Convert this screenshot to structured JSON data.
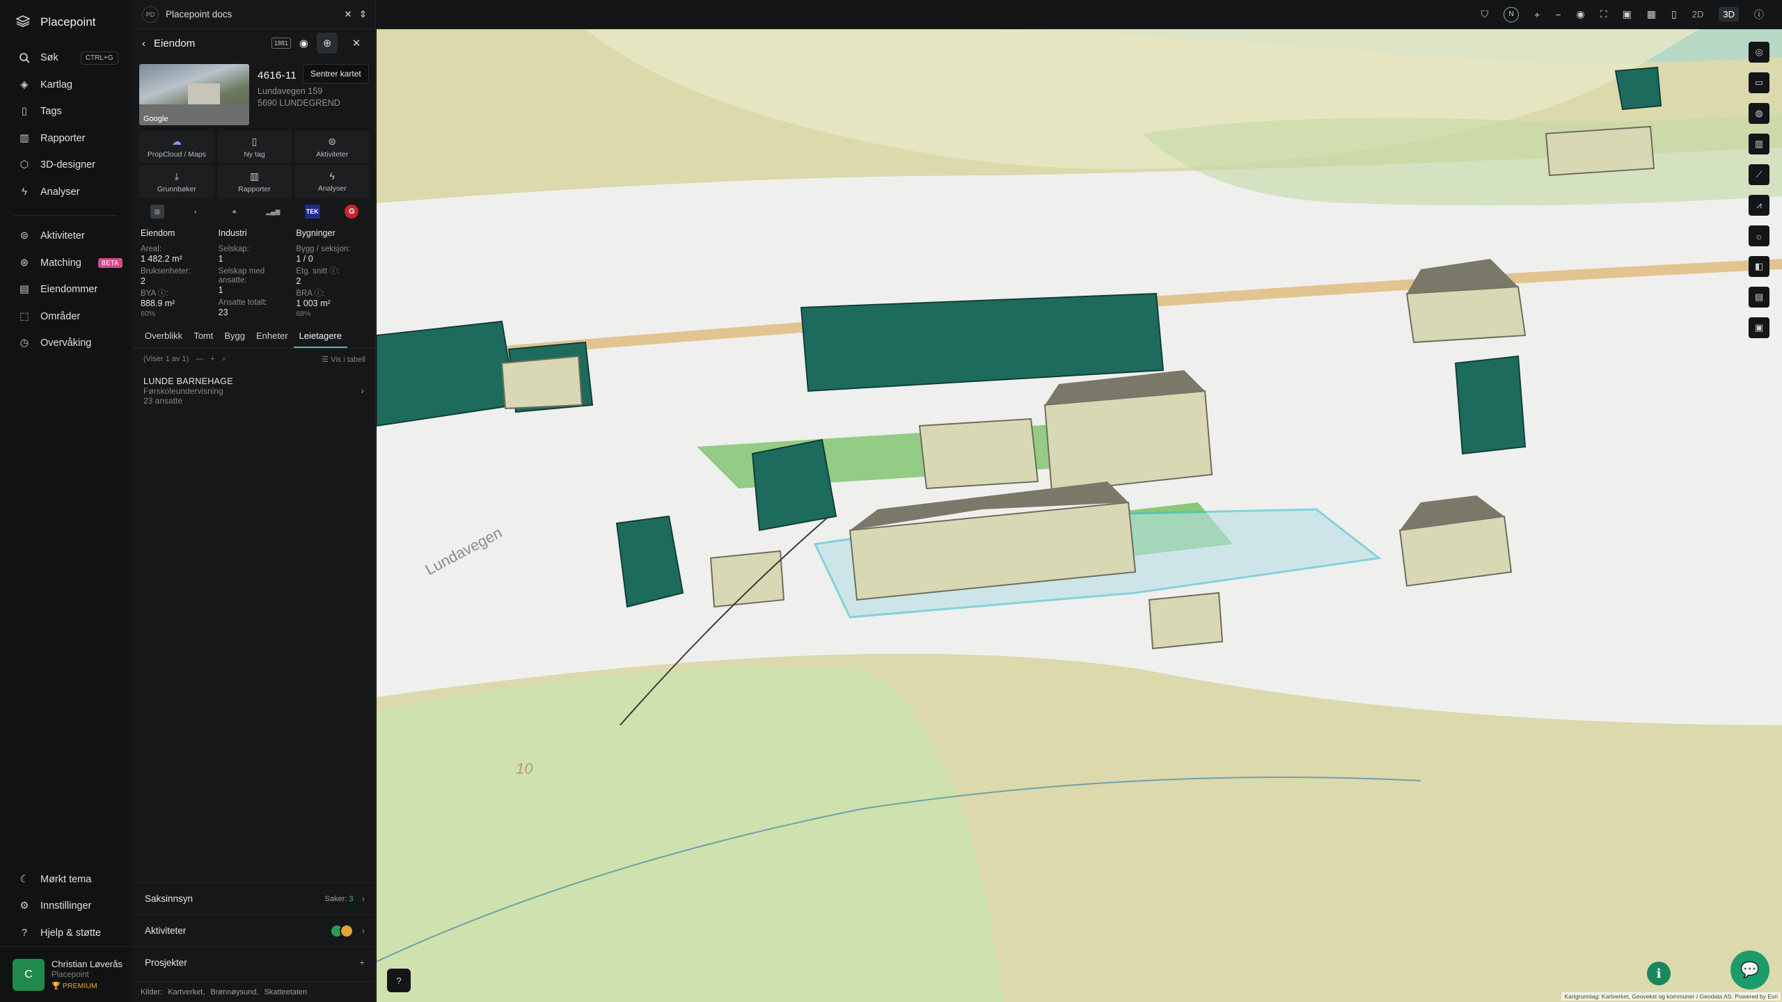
{
  "app": {
    "name": "Placepoint"
  },
  "nav": {
    "items": [
      {
        "label": "Søk",
        "shortcut": "CTRL+G"
      },
      {
        "label": "Kartlag"
      },
      {
        "label": "Tags"
      },
      {
        "label": "Rapporter"
      },
      {
        "label": "3D-designer"
      },
      {
        "label": "Analyser"
      }
    ],
    "items2": [
      {
        "label": "Aktiviteter"
      },
      {
        "label": "Matching",
        "badge": "BETA"
      },
      {
        "label": "Eiendommer"
      },
      {
        "label": "Områder"
      },
      {
        "label": "Overvåking"
      }
    ],
    "bottom": [
      {
        "label": "Mørkt tema"
      },
      {
        "label": "Innstillinger"
      },
      {
        "label": "Hjelp & støtte"
      }
    ],
    "user": {
      "initial": "C",
      "name": "Christian Løverås",
      "org": "Placepoint",
      "plan": "PREMIUM"
    }
  },
  "panel": {
    "doc_badge": "PD",
    "doc_title": "Placepoint docs",
    "header_title": "Eiendom",
    "mini_badge": "1881",
    "tooltip": "Sentrer kartet",
    "thumb_label": "Google",
    "property": {
      "id": "4616-11",
      "address1": "Lundavegen 159",
      "address2": "5690 LUNDEGREND"
    },
    "tiles": [
      {
        "label": "PropCloud / Maps"
      },
      {
        "label": "Ny tag"
      },
      {
        "label": "Aktiviteter"
      },
      {
        "label": "Grunnbøker"
      },
      {
        "label": "Rapporter"
      },
      {
        "label": "Analyser"
      }
    ],
    "sources": {
      "tek": "TEK",
      "g": "G"
    },
    "stats": {
      "eiendom": {
        "title": "Eiendom",
        "areal_l": "Areal:",
        "areal_v": "1 482.2 m²",
        "bruks_l": "Bruksenheter:",
        "bruks_v": "2",
        "bya_l": "BYA ⓘ:",
        "bya_v": "888.9 m²",
        "bya_p": "60%"
      },
      "industri": {
        "title": "Industri",
        "selskap_l": "Selskap:",
        "selskap_v": "1",
        "ansatte_l": "Selskap med ansatte:",
        "ansatte_v": "1",
        "totalt_l": "Ansatte totalt:",
        "totalt_v": "23"
      },
      "bygninger": {
        "title": "Bygninger",
        "bygg_l": "Bygg / seksjon:",
        "bygg_v": "1 / 0",
        "etg_l": "Etg. snitt ⓘ:",
        "etg_v": "2",
        "bra_l": "BRA ⓘ:",
        "bra_v": "1 003 m²",
        "bra_p": "68%"
      }
    },
    "tabs": [
      "Overblikk",
      "Tomt",
      "Bygg",
      "Enheter",
      "Leietagere"
    ],
    "subbar": {
      "count": "(Viser 1 av 1)",
      "table": "Vis i tabell"
    },
    "tenant": {
      "name": "LUNDE BARNEHAGE",
      "industry": "Førskoleundervisning",
      "employees": "23 ansatte"
    },
    "sections": {
      "saksinnsyn": {
        "label": "Saksinnsyn",
        "meta": "Saker:",
        "count": "3"
      },
      "aktiviteter": {
        "label": "Aktiviteter"
      },
      "prosjekter": {
        "label": "Prosjekter"
      }
    },
    "footer": {
      "label": "Kilder:",
      "s1": "Kartverket,",
      "s2": "Brønnøysund,",
      "s3": "Skatteetaten"
    }
  },
  "map": {
    "modes": [
      "2D",
      "3D"
    ],
    "road_label": "Lundavegen",
    "contour_label": "10",
    "attribution": "Kartgrunnlag: Kartverket, Geovekst og kommuner / Geodata AS. Powered by Esri"
  }
}
